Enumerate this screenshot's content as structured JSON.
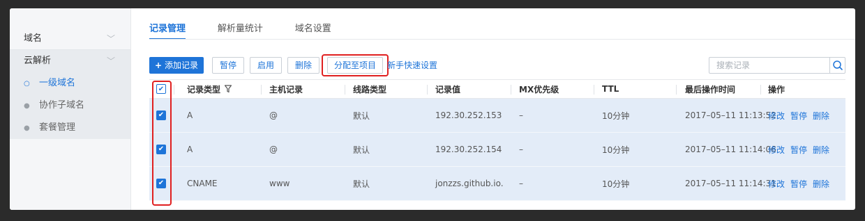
{
  "sidebar": {
    "domain_label": "域名",
    "dns_label": "云解析",
    "sub_items": [
      {
        "label": "一级域名",
        "active": true
      },
      {
        "label": "协作子域名",
        "active": false
      },
      {
        "label": "套餐管理",
        "active": false
      }
    ]
  },
  "tabs": [
    {
      "label": "记录管理",
      "active": true
    },
    {
      "label": "解析量统计",
      "active": false
    },
    {
      "label": "域名设置",
      "active": false
    }
  ],
  "toolbar": {
    "add_label": "添加记录",
    "pause_label": "暂停",
    "enable_label": "启用",
    "delete_label": "删除",
    "assign_label": "分配至项目",
    "quick_setup_label": "新手快速设置"
  },
  "search": {
    "placeholder": "搜索记录",
    "value": ""
  },
  "table": {
    "columns": [
      "记录类型",
      "主机记录",
      "线路类型",
      "记录值",
      "MX优先级",
      "TTL",
      "最后操作时间",
      "操作"
    ],
    "rows": [
      {
        "type": "A",
        "host": "@",
        "line": "默认",
        "value": "192.30.252.153",
        "mx": "–",
        "ttl": "10分钟",
        "time": "2017–05–11 11:13:52",
        "ops": [
          "修改",
          "暂停",
          "删除"
        ],
        "checked": true
      },
      {
        "type": "A",
        "host": "@",
        "line": "默认",
        "value": "192.30.252.154",
        "mx": "–",
        "ttl": "10分钟",
        "time": "2017–05–11 11:14:06",
        "ops": [
          "修改",
          "暂停",
          "删除"
        ],
        "checked": true
      },
      {
        "type": "CNAME",
        "host": "www",
        "line": "默认",
        "value": "jonzzs.github.io.",
        "mx": "–",
        "ttl": "10分钟",
        "time": "2017–05–11 11:14:31",
        "ops": [
          "修改",
          "暂停",
          "删除"
        ],
        "checked": true
      }
    ]
  },
  "colors": {
    "accent": "#1e74d8",
    "highlight": "#e02020",
    "row_selected": "#e3ecf8"
  },
  "icons": {
    "check": "✔",
    "chevron": "﹀"
  }
}
